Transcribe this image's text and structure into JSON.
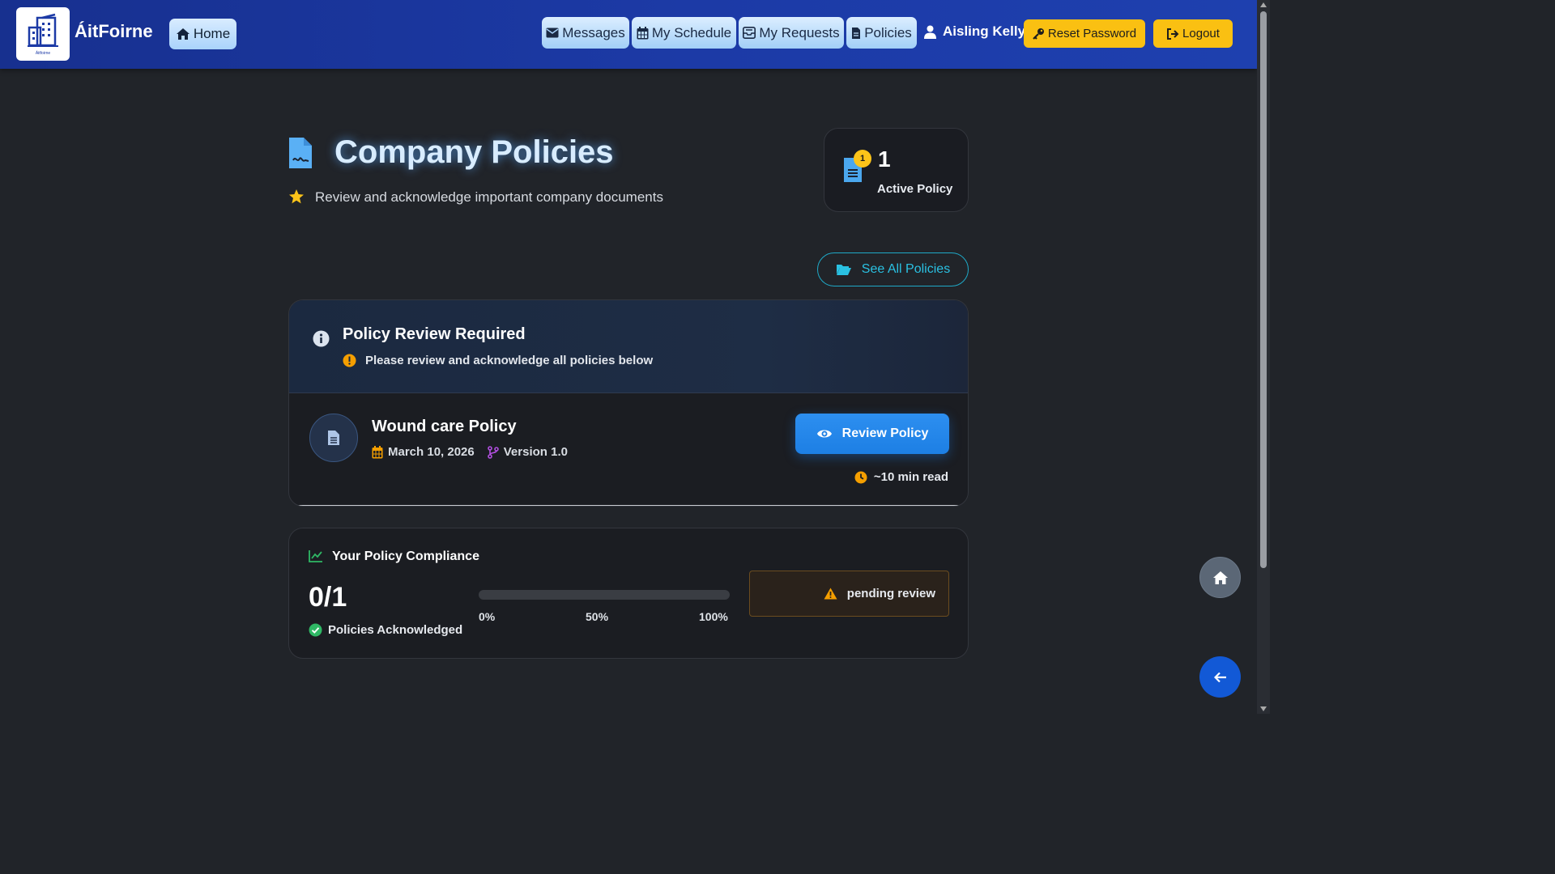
{
  "app": {
    "brand_name": "ÁitFoirne",
    "logo_small_text": "Áitfoirne"
  },
  "nav": {
    "home": "Home",
    "messages": "Messages",
    "schedule": "My Schedule",
    "requests": "My Requests",
    "policies": "Policies",
    "user_name": "Aisling Kelly",
    "reset_password": "Reset Password",
    "logout": "Logout"
  },
  "header": {
    "title": "Company Policies",
    "subtitle": "Review and acknowledge important company documents",
    "stat_count": "1",
    "stat_badge": "1",
    "stat_label": "Active Policy",
    "see_all": "See All Policies"
  },
  "review_notice": {
    "title": "Policy Review Required",
    "subtitle": "Please review and acknowledge all policies below"
  },
  "policies": [
    {
      "name": "Wound care Policy",
      "date": "March 10, 2026",
      "version": "Version 1.0",
      "button": "Review Policy",
      "read_time": "~10 min read"
    }
  ],
  "compliance": {
    "title": "Your Policy Compliance",
    "count": "0/1",
    "label": "Policies Acknowledged",
    "progress_fraction": 0,
    "ticks": [
      "0%",
      "50%",
      "100%"
    ],
    "status": "pending review"
  },
  "colors": {
    "accent_blue": "#2d8ff0",
    "warning_yellow": "#fac012",
    "teal": "#2ac1e2",
    "orange": "#f59f00"
  }
}
